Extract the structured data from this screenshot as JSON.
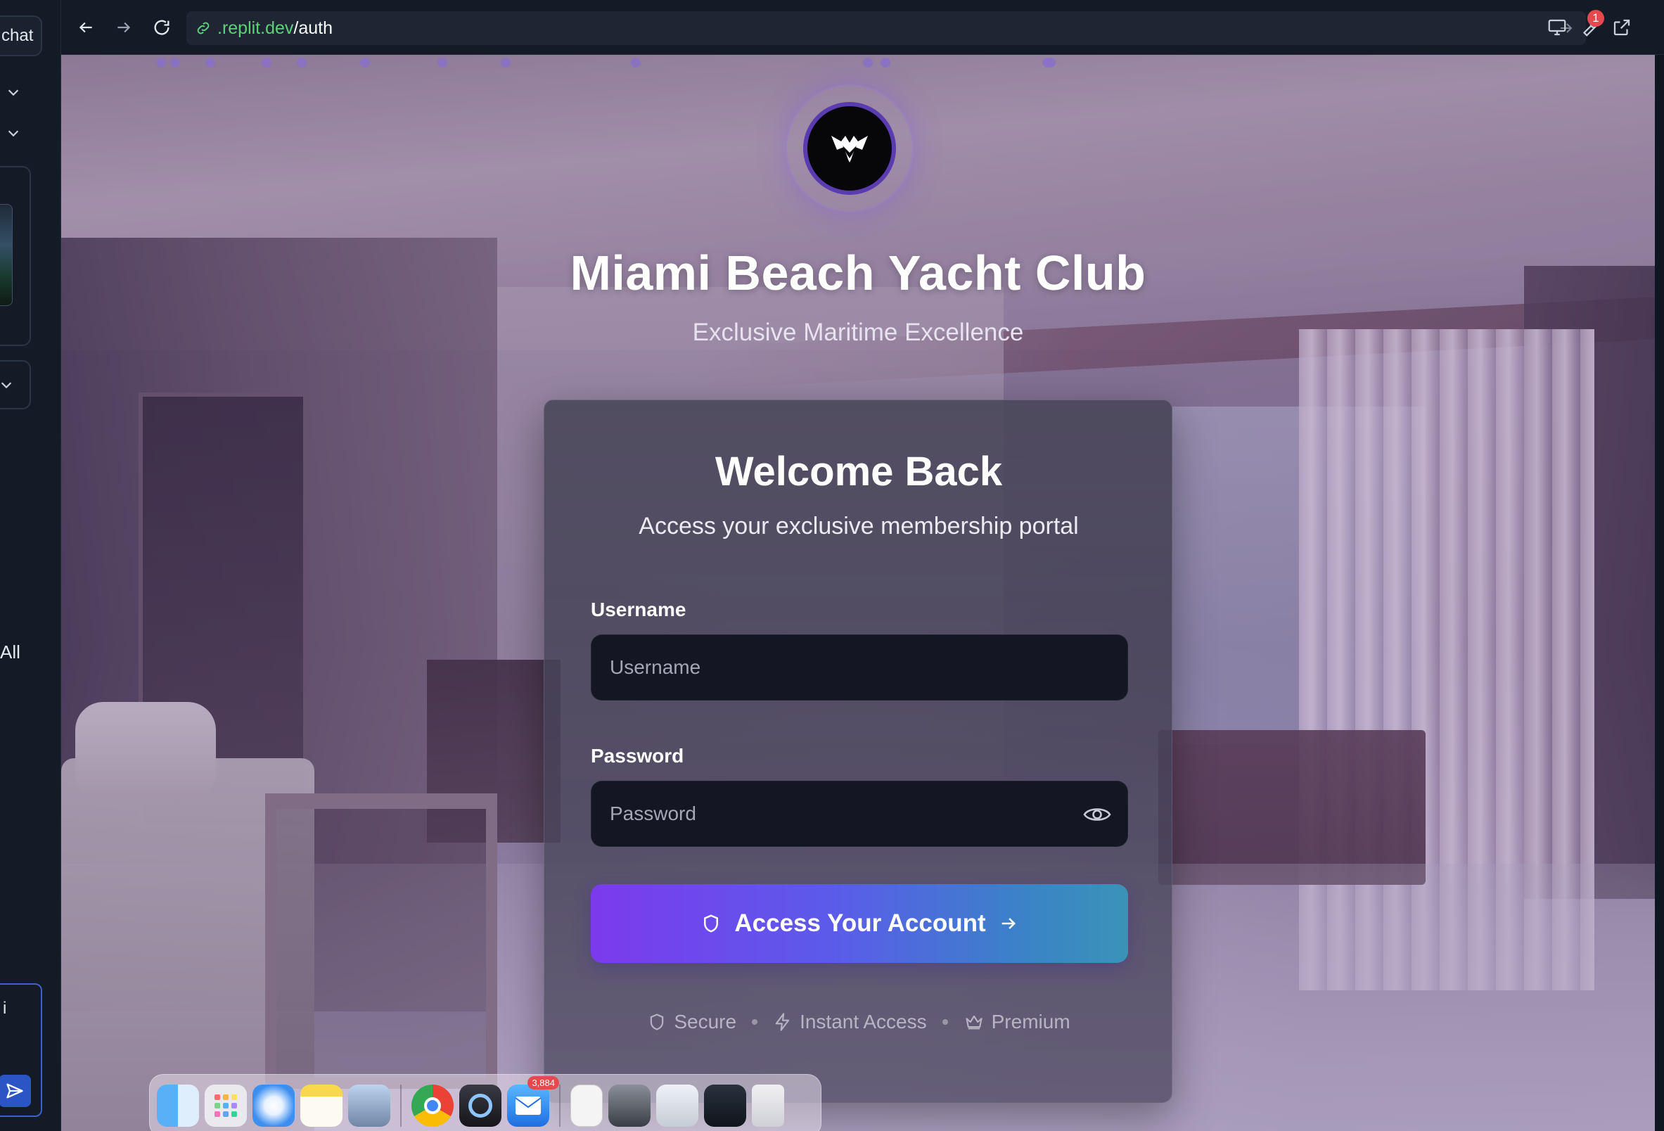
{
  "ide": {
    "chat_tab_label": "chat",
    "filter_all_label": "All",
    "chat_input_text": "i"
  },
  "browser": {
    "url_host": ".replit.dev",
    "url_path": "/auth",
    "notification_count": "1"
  },
  "page": {
    "club_name": "Miami Beach Yacht Club",
    "tagline": "Exclusive Maritime Excellence"
  },
  "login": {
    "title": "Welcome Back",
    "subtitle": "Access your exclusive membership portal",
    "username_label": "Username",
    "username_placeholder": "Username",
    "username_value": "",
    "password_label": "Password",
    "password_placeholder": "Password",
    "password_value": "",
    "submit_label": "Access Your Account",
    "features": [
      "Secure",
      "Instant Access",
      "Premium"
    ]
  },
  "dock": {
    "apps": [
      "finder",
      "launchpad",
      "safari",
      "notes",
      "preview",
      "chrome",
      "quicktime",
      "mail",
      "documents",
      "screenshot-1",
      "screenshot-2",
      "screenshot-3",
      "trash"
    ],
    "mail_badge": "3,884"
  },
  "colors": {
    "accent_start": "#7c3aed",
    "accent_end": "#3a93b7",
    "url_host": "#5fd07a",
    "badge": "#e5484d"
  }
}
